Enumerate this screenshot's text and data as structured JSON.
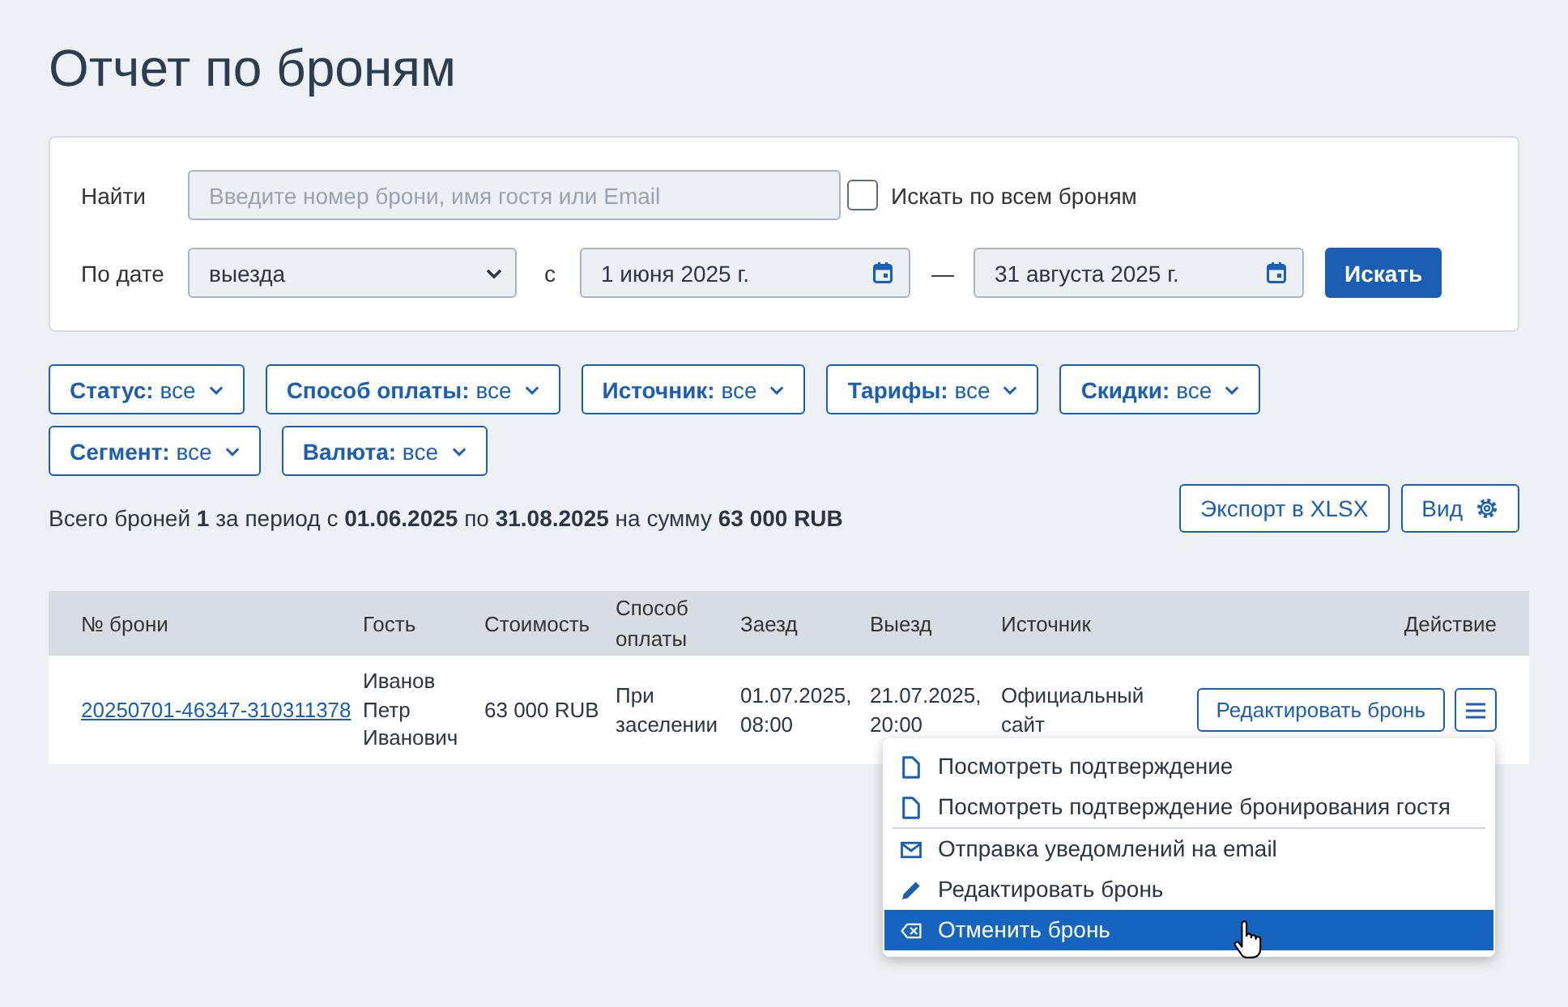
{
  "page": {
    "title": "Отчет по броням"
  },
  "search_panel": {
    "search": {
      "label": "Найти",
      "placeholder": "Введите номер брони, имя гостя или Email"
    },
    "all_bookings": {
      "label": "Искать по всем броням",
      "checked": false
    },
    "date": {
      "label": "По дате",
      "select_value": "выезда",
      "from_label": "с",
      "from": "1 июня 2025 г.",
      "separator": "—",
      "to": "31 августа 2025 г."
    },
    "search_button": "Искать"
  },
  "filters": [
    {
      "label": "Статус:",
      "value": "все"
    },
    {
      "label": "Способ оплаты:",
      "value": "все"
    },
    {
      "label": "Источник:",
      "value": "все"
    },
    {
      "label": "Тарифы:",
      "value": "все"
    },
    {
      "label": "Скидки:",
      "value": "все"
    },
    {
      "label": "Сегмент:",
      "value": "все"
    },
    {
      "label": "Валюта:",
      "value": "все"
    }
  ],
  "summary": "Всего броней **1** за период с **01.06.2025** по **31.08.2025** на сумму **63 000 RUB**",
  "toolbar": {
    "export_button": "Экспорт в XLSX",
    "view_button": "Вид"
  },
  "table": {
    "columns": [
      "№ брони",
      "Гость",
      "Стоимость",
      "Способ оплаты",
      "Заезд",
      "Выезд",
      "Источник",
      "Действие"
    ],
    "rows": [
      {
        "booking_number": "20250701-46347-310311378",
        "guest": "Иванов Петр Иванович",
        "cost": "63 000 RUB",
        "payment": "При заселении",
        "check_in": "01.07.2025, 08:00",
        "check_out": "21.07.2025, 20:00",
        "source": "Официальный сайт",
        "edit_button": "Редактировать бронь"
      }
    ]
  },
  "action_menu": {
    "sections": [
      {
        "items": [
          {
            "kind": "document",
            "label": "Посмотреть подтверждение",
            "highlighted": false
          },
          {
            "kind": "document",
            "label": "Посмотреть подтверждение бронирования гостя",
            "highlighted": false
          }
        ]
      },
      {
        "items": [
          {
            "kind": "email",
            "label": "Отправка уведомлений на email",
            "highlighted": false
          },
          {
            "kind": "edit",
            "label": "Редактировать бронь",
            "highlighted": false
          },
          {
            "kind": "cancel",
            "label": "Отменить бронь",
            "highlighted": true
          }
        ]
      }
    ]
  }
}
